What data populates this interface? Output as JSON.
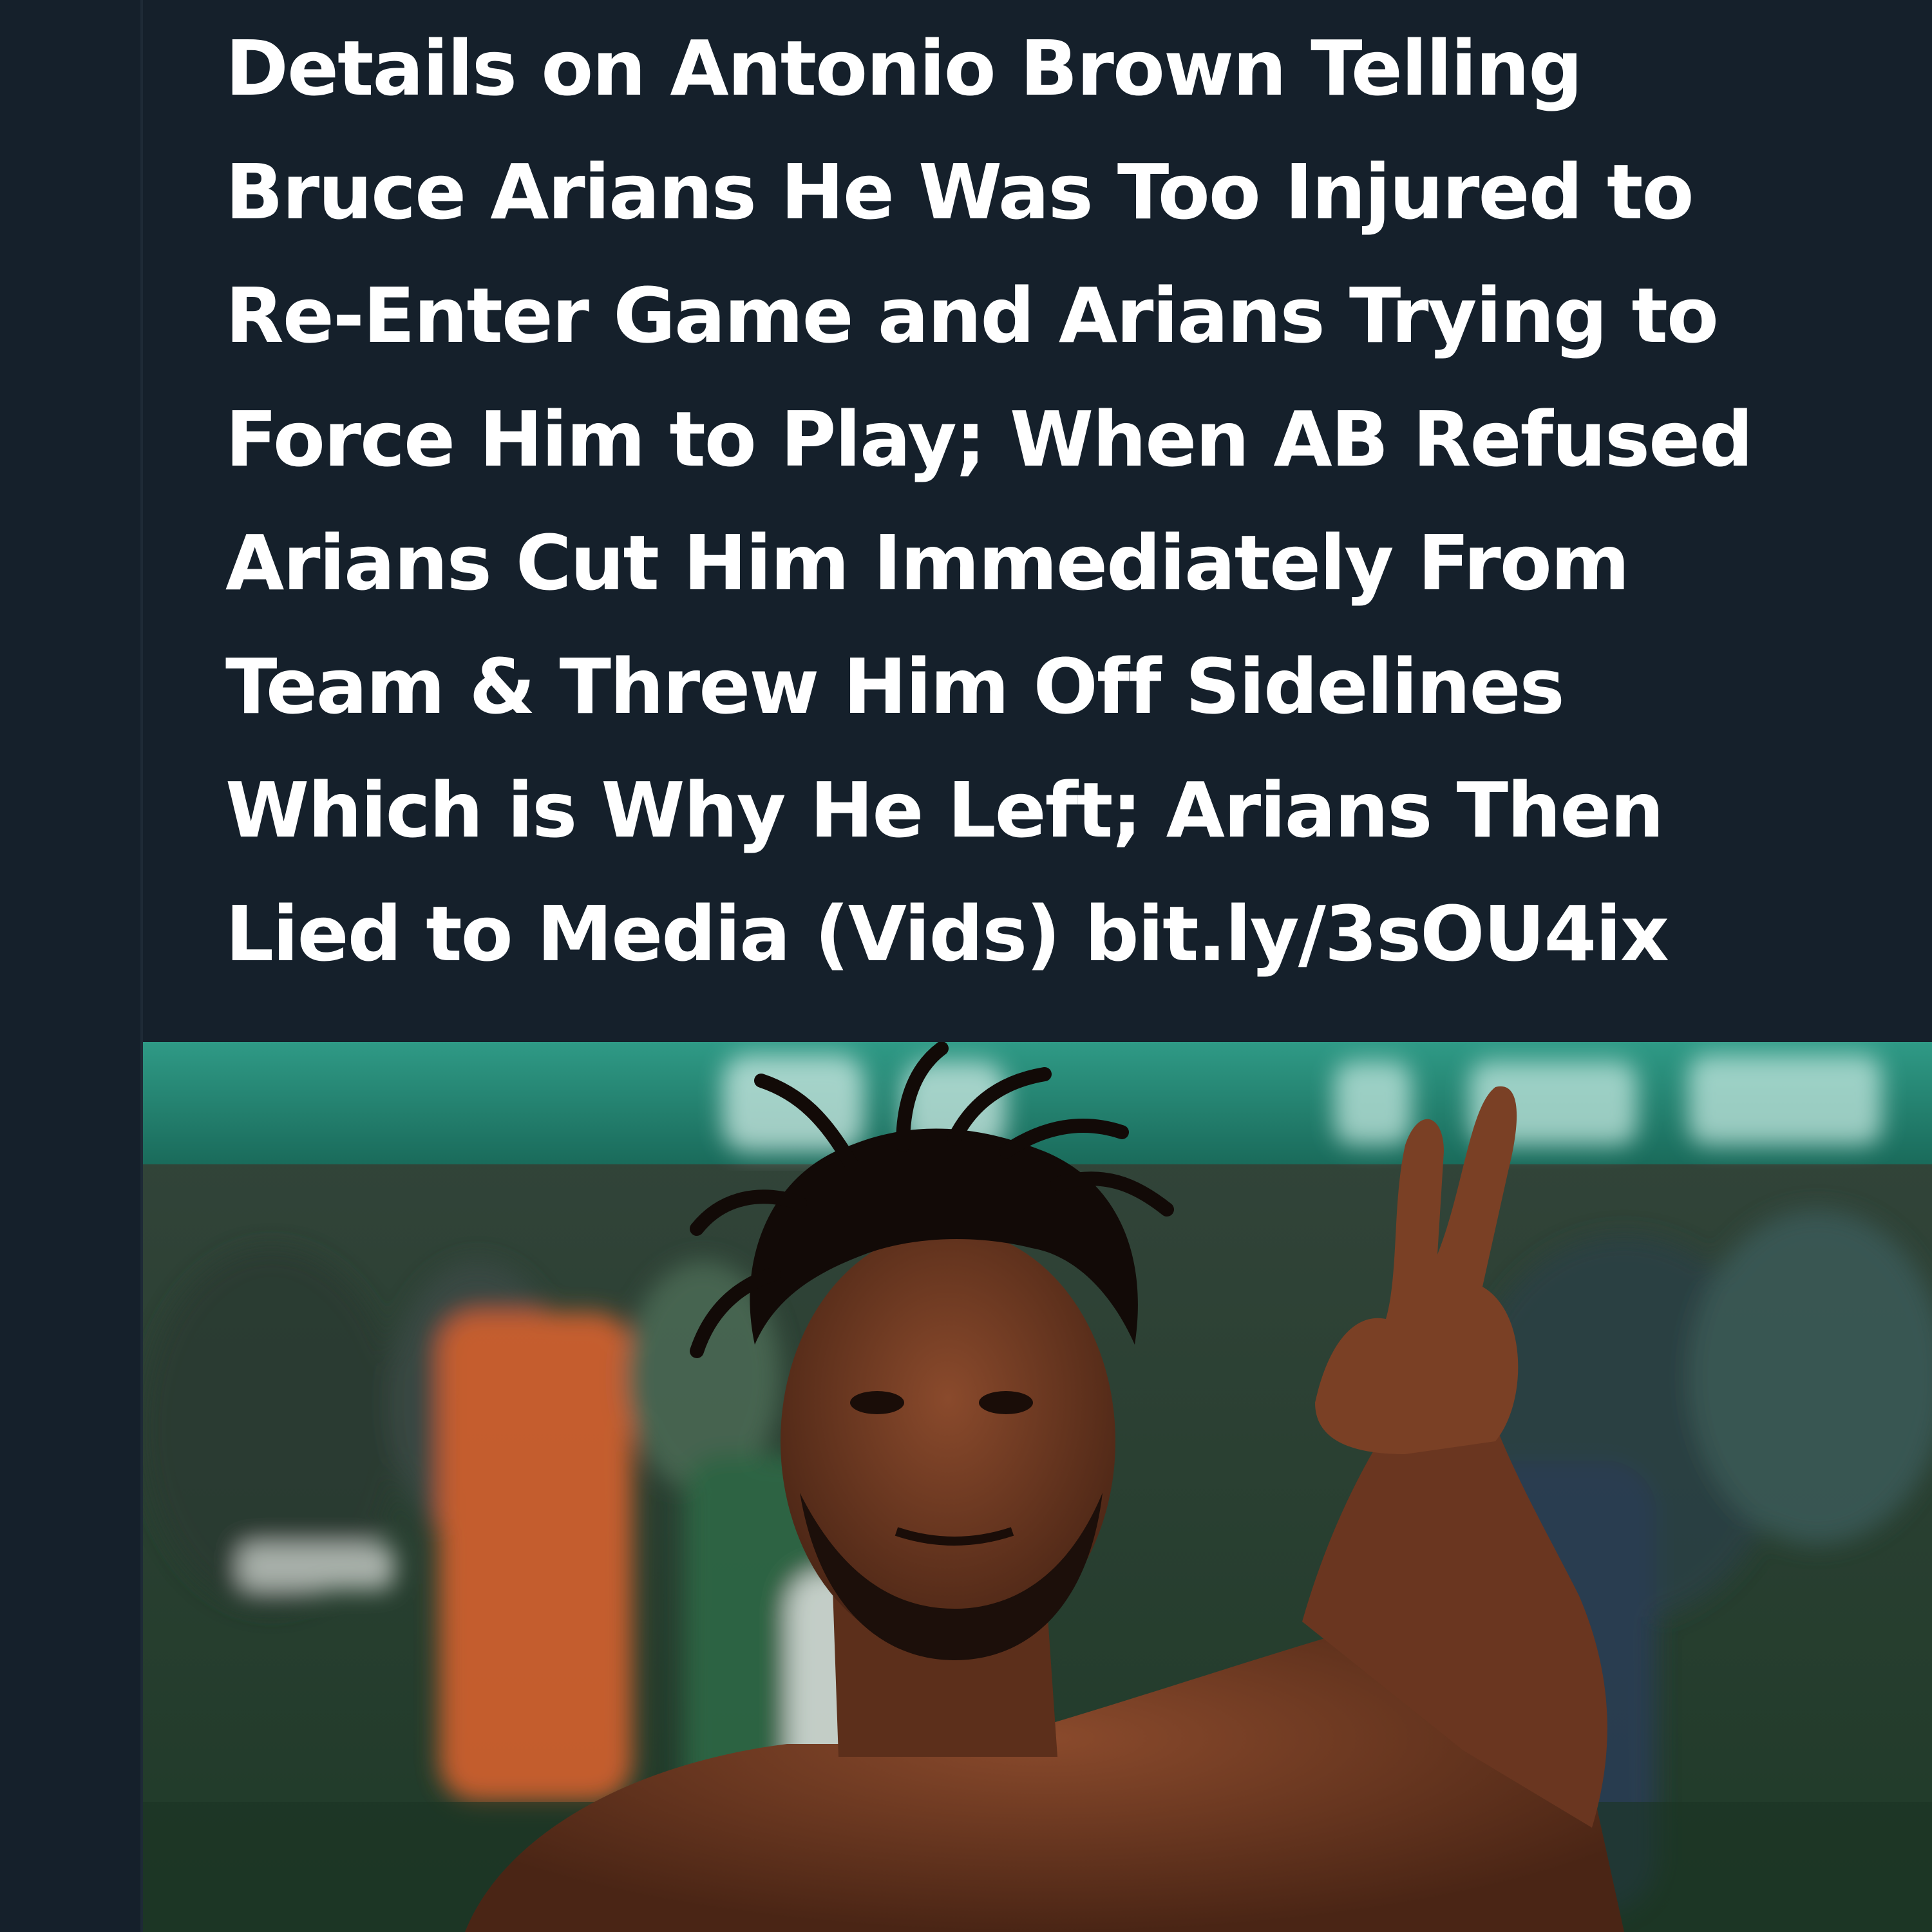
{
  "tweet": {
    "text_lines": [
      "Details on Antonio Brown Telling",
      "Bruce Arians He Was Too Injured to",
      "Re-Enter Game and Arians Trying to",
      "Force Him to Play; When AB Refused",
      "Arians Cut Him Immediately From",
      "Team & Threw Him Off Sidelines",
      "Which is Why He Left; Arians Then",
      "Lied to Media (Vids) "
    ],
    "link_text": "bit.ly/3sOU4ix"
  },
  "colors": {
    "background": "#15202b",
    "text": "#ffffff"
  }
}
